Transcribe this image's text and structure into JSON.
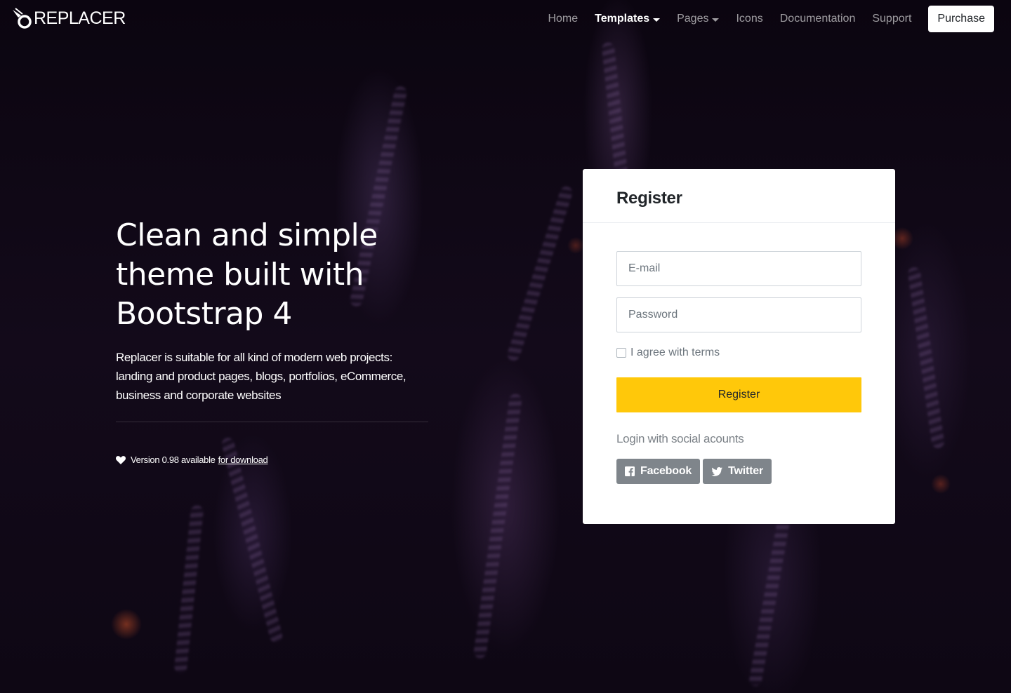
{
  "brand": {
    "name": "REPLACER"
  },
  "nav": {
    "items": [
      {
        "label": "Home",
        "active": false,
        "dropdown": false
      },
      {
        "label": "Templates",
        "active": true,
        "dropdown": true
      },
      {
        "label": "Pages",
        "active": false,
        "dropdown": true
      },
      {
        "label": "Icons",
        "active": false,
        "dropdown": false
      },
      {
        "label": "Documentation",
        "active": false,
        "dropdown": false
      },
      {
        "label": "Support",
        "active": false,
        "dropdown": false
      }
    ],
    "purchase_label": "Purchase"
  },
  "hero": {
    "title": "Clean and simple theme built with Bootstrap 4",
    "description": "Replacer is suitable for all kind of modern web projects: landing and product pages, blogs, portfolios, eCommerce, business and corporate websites",
    "version_text": "Version 0.98 available",
    "download_link": "for download"
  },
  "register_card": {
    "title": "Register",
    "email_placeholder": "E-mail",
    "password_placeholder": "Password",
    "terms_label": "I agree with terms",
    "submit_label": "Register",
    "social_label": "Login with social acounts",
    "facebook_label": "Facebook",
    "twitter_label": "Twitter"
  },
  "colors": {
    "accent": "#ffc80a",
    "social_button": "#7f858b",
    "background": "#0c0610"
  },
  "icons": [
    "logo-mark-icon",
    "caret-down-icon",
    "heart-icon",
    "facebook-icon",
    "twitter-icon"
  ]
}
